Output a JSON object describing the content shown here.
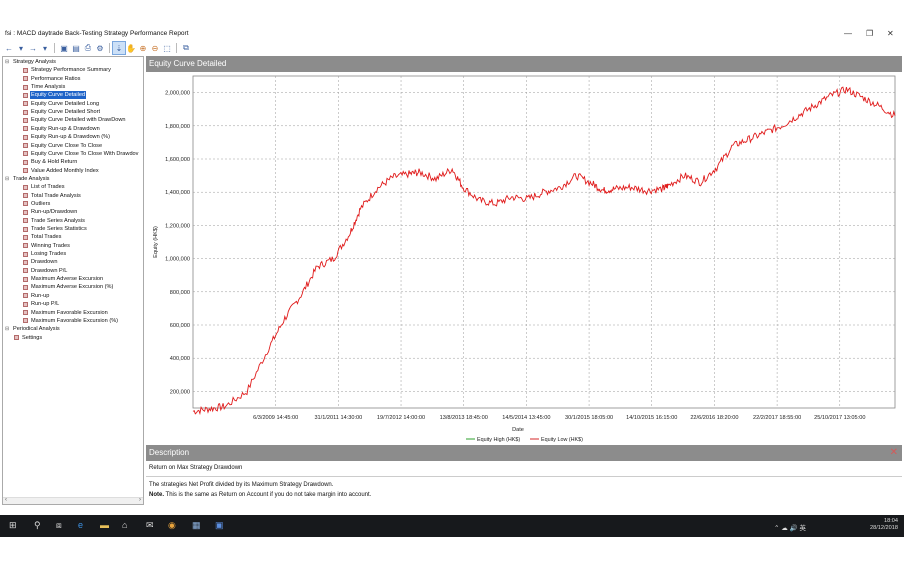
{
  "window": {
    "title": "fsi : MACD daytrade Back-Testing Strategy Performance Report",
    "minimize": "—",
    "restore": "❐",
    "close": "✕"
  },
  "toolbar": {
    "icons": [
      "back-icon",
      "back-dropdown-icon",
      "forward-icon",
      "forward-dropdown-icon",
      "save-icon",
      "open-icon",
      "print-icon",
      "settings-icon",
      "pointer-icon",
      "pan-icon",
      "zoom-in-icon",
      "zoom-out-icon",
      "fit-icon",
      "export-icon"
    ]
  },
  "tree": {
    "groups": [
      {
        "label": "Strategy Analysis",
        "items": [
          "Strategy Performance Summary",
          "Performance Ratios",
          "Time Analysis",
          "Equity Curve Detailed",
          "Equity Curve Detailed Long",
          "Equity Curve Detailed Short",
          "Equity Curve Detailed with DrawDown",
          "Equity Run-up & Drawdown",
          "Equity Run-up & Drawdown (%)",
          "Equity Curve Close To Close",
          "Equity Curve Close To Close With Drawdov",
          "Buy & Hold Return",
          "Value Added Monthly Index"
        ]
      },
      {
        "label": "Trade Analysis",
        "items": [
          "List of Trades",
          "Total Trade Analysis",
          "Outliers",
          "Run-up/Drawdown",
          "Trade Series Analysis",
          "Trade Series Statistics",
          "Total Trades",
          "Winning Trades",
          "Losing Trades",
          "Drawdown",
          "Drawdown P/L",
          "Maximum Adverse Excursion",
          "Maximum Adverse Excursion (%)",
          "Run-up",
          "Run-up P/L",
          "Maximum Favorable Excursion",
          "Maximum Favorable Excursion (%)"
        ]
      },
      {
        "label": "Periodical Analysis",
        "items": []
      }
    ],
    "settings": "Settings",
    "selected": "Equity Curve Detailed"
  },
  "panel": {
    "title": "Equity Curve Detailed"
  },
  "chart_data": {
    "type": "line",
    "title": "",
    "xlabel": "Date",
    "ylabel": "Equity (HK$)",
    "ylim": [
      100000,
      2100000
    ],
    "yticks": [
      "200,000",
      "400,000",
      "600,000",
      "800,000",
      "1,000,000",
      "1,200,000",
      "1,400,000",
      "1,600,000",
      "1,800,000",
      "2,000,000"
    ],
    "ytick_values": [
      200000,
      400000,
      600000,
      800000,
      1000000,
      1200000,
      1400000,
      1600000,
      1800000,
      2000000
    ],
    "xticks": [
      "6/3/2009 14:45:00",
      "31/1/2011 14:30:00",
      "19/7/2012 14:00:00",
      "13/8/2013 18:45:00",
      "14/5/2014 13:45:00",
      "30/1/2015 18:05:00",
      "14/10/2015 16:15:00",
      "22/6/2016 18:20:00",
      "22/2/2017 18:55:00",
      "25/10/2017 13:05:00"
    ],
    "grid": true,
    "legend": [
      "Equity High (HK$)",
      "Equity Low (HK$)"
    ],
    "legend_colors": [
      "#2ca02c",
      "#d62728"
    ],
    "series": [
      {
        "name": "Equity Low (HK$)",
        "color": "#e01b1b",
        "x_index": [
          0,
          0.3,
          0.6,
          1.0,
          1.4,
          1.7,
          2.0,
          2.3,
          2.6,
          2.9,
          3.1,
          3.4,
          3.7,
          4.0,
          4.2,
          4.5,
          4.8,
          5.0,
          5.3,
          5.6,
          5.9,
          6.2,
          6.5,
          6.8,
          7.1,
          7.4,
          7.6,
          7.8,
          8.1,
          8.4,
          8.7,
          8.8,
          9.1,
          9.4,
          9.7,
          10.0,
          10.3,
          10.6,
          10.9,
          11.2,
          11.5,
          11.8,
          12.1,
          12.4,
          12.7,
          13.0
        ],
        "values": [
          80000,
          95000,
          110000,
          200000,
          460000,
          640000,
          780000,
          950000,
          1000000,
          1150000,
          1300000,
          1420000,
          1490000,
          1510000,
          1520000,
          1480000,
          1540000,
          1430000,
          1350000,
          1330000,
          1370000,
          1360000,
          1400000,
          1430000,
          1500000,
          1450000,
          1410000,
          1420000,
          1430000,
          1410000,
          1420000,
          1440000,
          1500000,
          1460000,
          1550000,
          1680000,
          1720000,
          1760000,
          1800000,
          1860000,
          1920000,
          1980000,
          2020000,
          1970000,
          1920000,
          1860000
        ]
      }
    ]
  },
  "description": {
    "header": "Description",
    "title": "Return on Max Strategy Drawdown",
    "text": "The strategies Net Profit divided by its Maximum Strategy Drawdown.",
    "note_label": "Note.",
    "note": " This is the same as Return on Account if you do not take margin into account."
  },
  "taskbar": {
    "icons": [
      "windows-icon",
      "search-icon",
      "task-view-icon",
      "edge-icon",
      "file-explorer-icon",
      "store-icon",
      "mail-icon",
      "chrome-icon",
      "app-icon",
      "app-icon-2"
    ],
    "tray": "⌃ ☁ 🔊 英",
    "time": "18:04",
    "date": "28/12/2018"
  }
}
